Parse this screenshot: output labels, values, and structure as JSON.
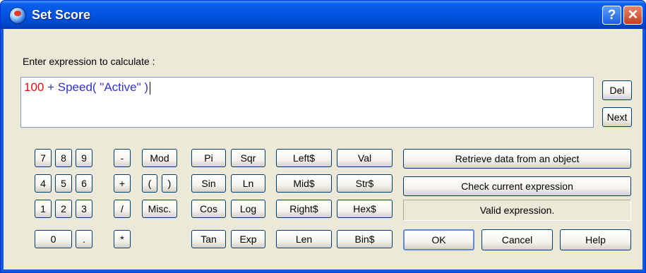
{
  "window": {
    "title": "Set Score",
    "help_glyph": "?",
    "close_glyph": "✕"
  },
  "prompt": "Enter expression to calculate :",
  "expression": {
    "number": "100",
    "op": " + ",
    "fn": "Speed(",
    "arg": " \"Active\" ",
    "close": ")"
  },
  "side": {
    "del": "Del",
    "next": "Next"
  },
  "keypad": {
    "n7": "7",
    "n8": "8",
    "n9": "9",
    "minus": "-",
    "mod": "Mod",
    "n4": "4",
    "n5": "5",
    "n6": "6",
    "plus": "+",
    "lparen": "(",
    "rparen": ")",
    "n1": "1",
    "n2": "2",
    "n3": "3",
    "div": "/",
    "misc": "Misc.",
    "n0": "0",
    "dot": ".",
    "mul": "*"
  },
  "math": {
    "pi": "Pi",
    "sqr": "Sqr",
    "sin": "Sin",
    "ln": "Ln",
    "cos": "Cos",
    "log": "Log",
    "tan": "Tan",
    "exp": "Exp"
  },
  "strings": {
    "left": "Left$",
    "val": "Val",
    "mid": "Mid$",
    "str": "Str$",
    "right": "Right$",
    "hex": "Hex$",
    "len": "Len",
    "bin": "Bin$"
  },
  "actions": {
    "retrieve": "Retrieve data from an object",
    "check": "Check current expression",
    "status": "Valid expression."
  },
  "footer": {
    "ok": "OK",
    "cancel": "Cancel",
    "help": "Help"
  }
}
